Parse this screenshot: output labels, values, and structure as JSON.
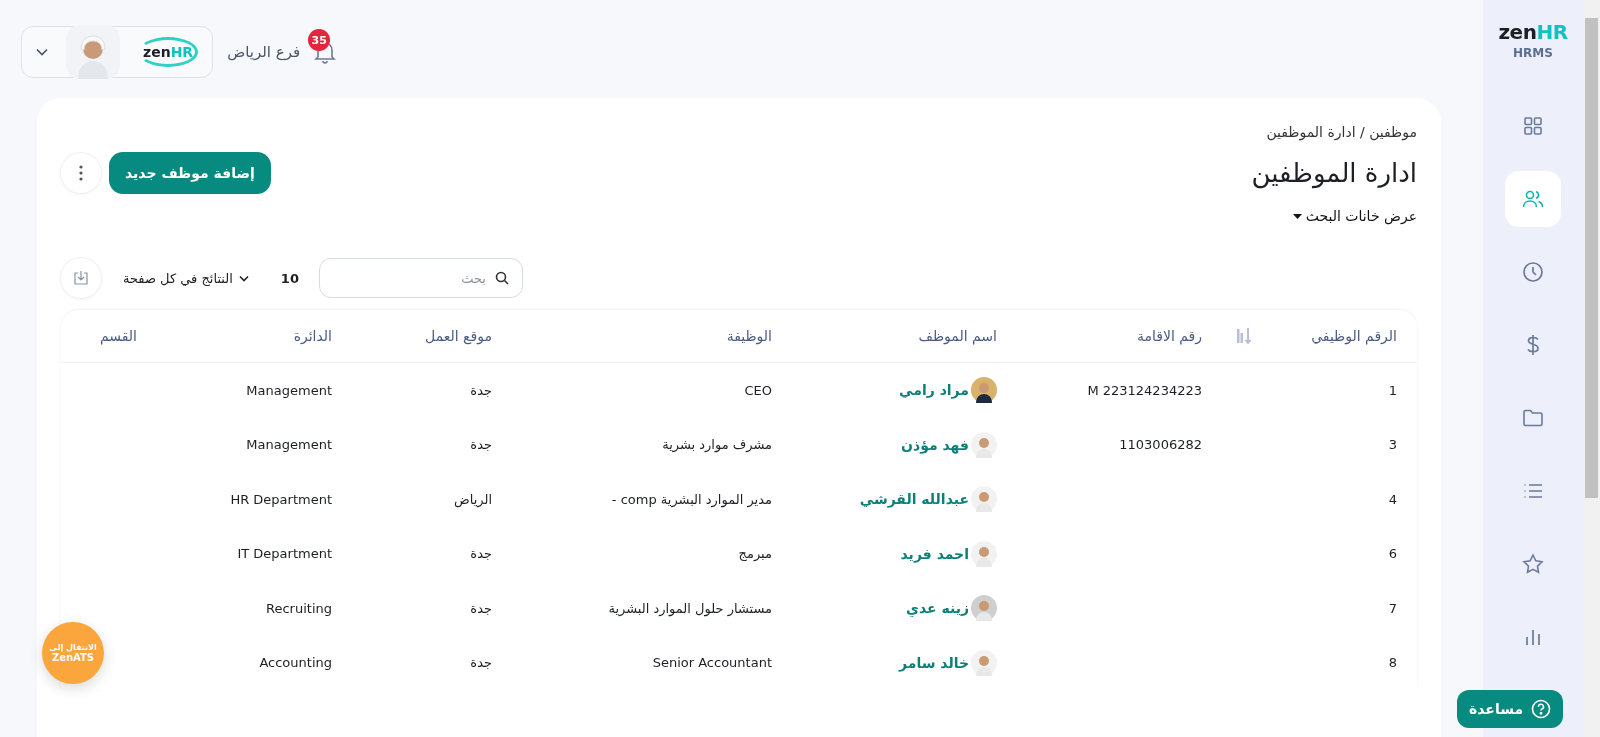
{
  "header": {
    "notification_count": "35",
    "branch": "فرع الرياض",
    "user_logo": {
      "dark": "zen",
      "accent": "HR"
    }
  },
  "sidebar": {
    "logo": {
      "dark": "zen",
      "accent": "HR"
    },
    "product": "HRMS",
    "items": [
      {
        "kind": "grid",
        "selected": false
      },
      {
        "kind": "people",
        "selected": true
      },
      {
        "kind": "clock",
        "selected": false
      },
      {
        "kind": "dollar",
        "selected": false
      },
      {
        "kind": "folder",
        "selected": false
      },
      {
        "kind": "list",
        "selected": false
      },
      {
        "kind": "star",
        "selected": false
      },
      {
        "kind": "chart",
        "selected": false
      }
    ]
  },
  "page": {
    "breadcrumb": "موظفين / ادارة الموظفين",
    "title": "ادارة الموظفين",
    "filters_toggle": "عرض خانات البحث",
    "add_button": "إضافة موظف جديد",
    "search": {
      "placeholder": "بحث"
    },
    "page_size": "10",
    "page_size_label": "النتائج في كل صفحة"
  },
  "table": {
    "columns": [
      "الرقم الوظيفي",
      "رقم الاقامة",
      "اسم الموظف",
      "الوظيفة",
      "موقع العمل",
      "الدائرة",
      "القسم"
    ],
    "rows": [
      {
        "id": "1",
        "iqama": "M 223124234223",
        "name": "مراد رامي",
        "job": "CEO",
        "location": "جدة",
        "department": "Management"
      },
      {
        "id": "3",
        "iqama": "1103006282",
        "name": "فهد مؤذن",
        "job": "مشرف موارد بشرية",
        "location": "جدة",
        "department": "Management"
      },
      {
        "id": "4",
        "name": "عبدالله القرشي",
        "job": "مدير الموارد البشرية comp -",
        "location": "الرياض",
        "department": "HR Department"
      },
      {
        "id": "6",
        "name": "احمد فريد",
        "job": "مبرمج",
        "location": "جدة",
        "department": "IT Department"
      },
      {
        "id": "7",
        "name": "زينه عدي",
        "job": "مستشار حلول الموارد البشرية",
        "location": "جدة",
        "department": "Recruiting"
      },
      {
        "id": "8",
        "name": "خالد سامر",
        "job": "Senior Accountant",
        "location": "جدة",
        "department": "Accounting"
      }
    ]
  },
  "ats_button": {
    "line1": "الانتقال إلى",
    "line2": "ZenATS"
  },
  "help_button": "مساعدة"
}
